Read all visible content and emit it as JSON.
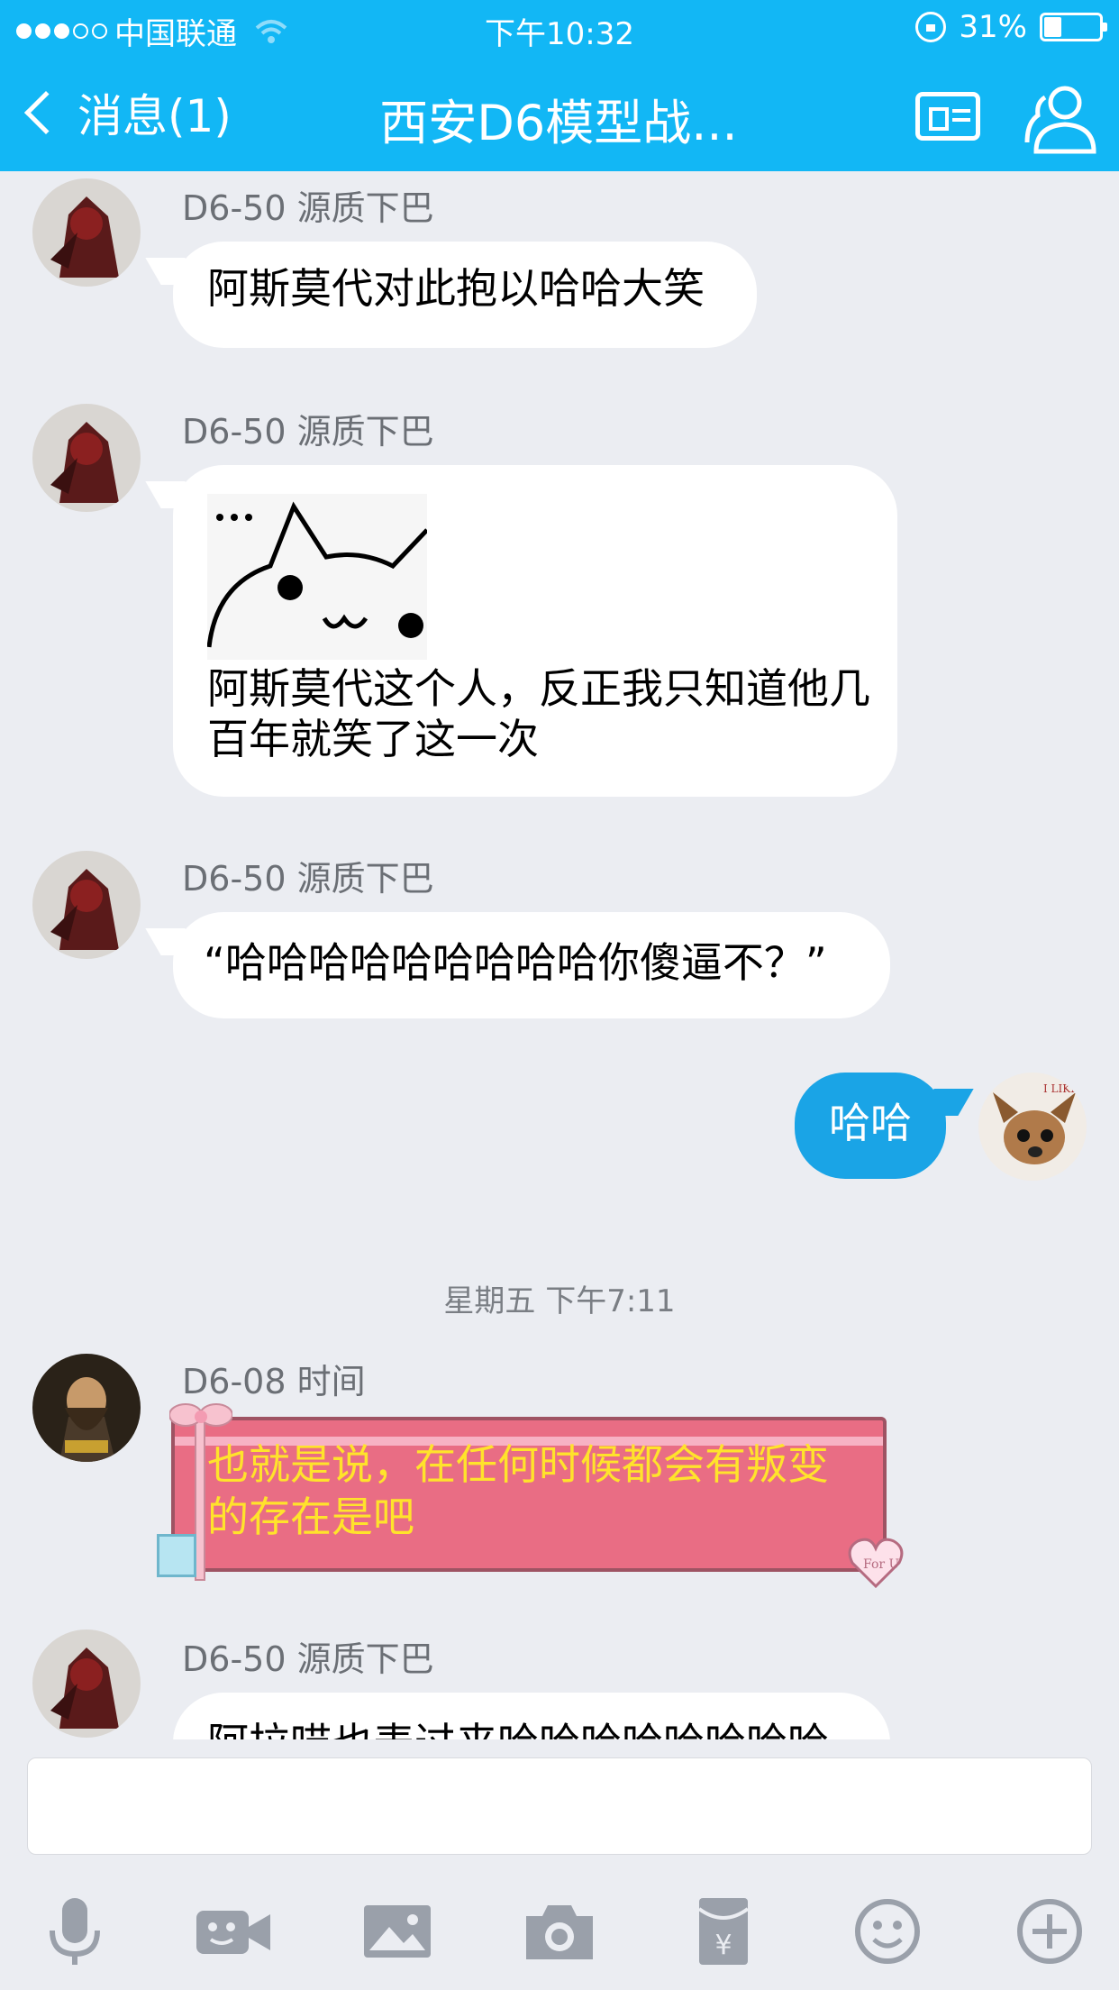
{
  "status_bar": {
    "carrier": "中国联通",
    "time": "下午10:32",
    "battery_percent": "31%",
    "battery_level": 0.31,
    "signal_bars_on": 3,
    "signal_bars_total": 5
  },
  "nav": {
    "back_label": "消息(1)",
    "title": "西安D6模型战..."
  },
  "messages": [
    {
      "sender": "D6-50 源质下巴",
      "text": "阿斯莫代对此抱以哈哈大笑"
    },
    {
      "sender": "D6-50 源质下巴",
      "text": " 阿斯莫代这个人，反正我只知道他几百年就笑了这一次",
      "sticker": "cat-sticker"
    },
    {
      "sender": "D6-50 源质下巴",
      "text": "“哈哈哈哈哈哈哈哈哈你傻逼不？”"
    },
    {
      "mine": true,
      "text": "哈哈",
      "avatar_text": "I LIKE"
    },
    {
      "sender": "D6-08 时间",
      "text": "也就是说，在任何时候都会有叛变的存在是吧",
      "style": "gift"
    },
    {
      "sender": "D6-50 源质下巴",
      "text": "阿拉喵也表过来哈哈哈哈哈哈哈哈"
    }
  ],
  "timestamp": "星期五 下午7:11",
  "gift_tag": "For U",
  "input": {
    "value": "",
    "placeholder": ""
  },
  "toolbar": [
    "mic-icon",
    "video-icon",
    "image-icon",
    "camera-icon",
    "red-packet-icon",
    "emoji-icon",
    "plus-icon"
  ],
  "colors": {
    "header": "#12b7f5",
    "my_bubble": "#1aa4e6",
    "gift_bubble": "#e96d84",
    "gift_text": "#ffe32b"
  }
}
